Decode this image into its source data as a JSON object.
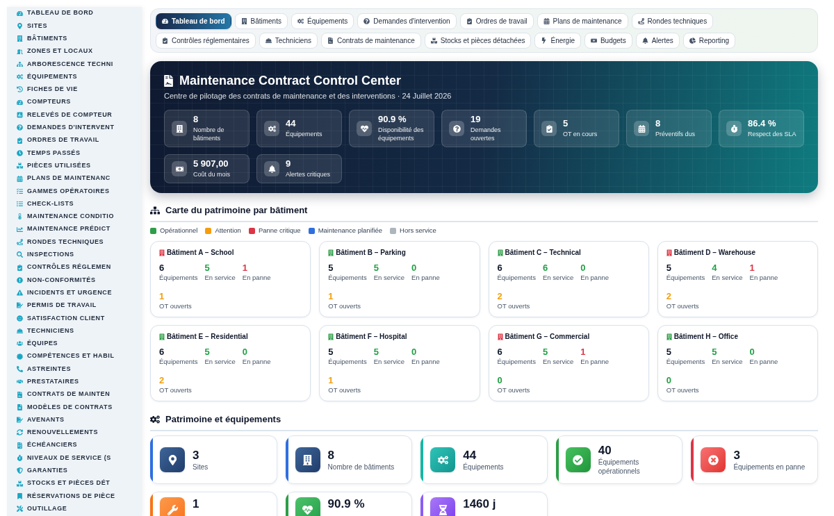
{
  "sidebar": {
    "items": [
      "TABLEAU DE BORD",
      "SITES",
      "BÂTIMENTS",
      "ZONES ET LOCAUX",
      "ARBORESCENCE TECHNI",
      "ÉQUIPEMENTS",
      "FICHES DE VIE",
      "COMPTEURS",
      "RELEVÉS DE COMPTEUR",
      "DEMANDES D'INTERVENT",
      "ORDRES DE TRAVAIL",
      "TEMPS PASSÉS",
      "PIÈCES UTILISÉES",
      "PLANS DE MAINTENANC",
      "GAMMES OPÉRATOIRES",
      "CHECK-LISTS",
      "MAINTENANCE CONDITIO",
      "MAINTENANCE PRÉDICT",
      "RONDES TECHNIQUES",
      "INSPECTIONS",
      "CONTRÔLES RÉGLEMEN",
      "NON-CONFORMITÉS",
      "INCIDENTS ET URGENCE",
      "PERMIS DE TRAVAIL",
      "SATISFACTION CLIENT",
      "TECHNICIENS",
      "ÉQUIPES",
      "COMPÉTENCES ET HABIL",
      "ASTREINTES",
      "PRESTATAIRES",
      "CONTRATS DE MAINTEN",
      "MODÈLES DE CONTRATS",
      "AVENANTS",
      "RENOUVELLEMENTS",
      "ÉCHÉANCIERS",
      "NIVEAUX DE SERVICE (S",
      "GARANTIES",
      "STOCKS ET PIÈCES DÉT",
      "RÉSERVATIONS DE PIÈCE",
      "OUTILLAGE"
    ]
  },
  "tab_rows": [
    [
      {
        "label": "Tableau de bord",
        "selected": true
      },
      {
        "label": "Bâtiments",
        "selected": false
      },
      {
        "label": "Équipements",
        "selected": false
      },
      {
        "label": "Demandes d'intervention",
        "selected": false
      },
      {
        "label": "Ordres de travail",
        "selected": false
      },
      {
        "label": "Plans de maintenance",
        "selected": false
      },
      {
        "label": "Rondes techniques",
        "selected": false
      }
    ],
    [
      {
        "label": "Contrôles réglementaires",
        "selected": false
      },
      {
        "label": "Techniciens",
        "selected": false
      },
      {
        "label": "Contrats de maintenance",
        "selected": false
      },
      {
        "label": "Stocks et pièces détachées",
        "selected": false
      },
      {
        "label": "Énergie",
        "selected": false
      },
      {
        "label": "Budgets",
        "selected": false
      },
      {
        "label": "Alertes",
        "selected": false
      },
      {
        "label": "Reporting",
        "selected": false
      }
    ]
  ],
  "hero": {
    "title": "Maintenance Contract Control Center",
    "subtitle": "Centre de pilotage des contrats de maintenance et des interventions · 24 Juillet 2026",
    "stats": [
      {
        "value": "8",
        "label": "Nombre de bâtiments"
      },
      {
        "value": "44",
        "label": "Équipements"
      },
      {
        "value": "90.9 %",
        "label": "Disponibilité des équipements"
      },
      {
        "value": "19",
        "label": "Demandes ouvertes"
      },
      {
        "value": "5",
        "label": "OT en cours"
      },
      {
        "value": "8",
        "label": "Préventifs dus"
      },
      {
        "value": "86.4 %",
        "label": "Respect des SLA"
      },
      {
        "value": "5 907,00",
        "label": "Coût du mois"
      },
      {
        "value": "9",
        "label": "Alertes critiques"
      }
    ]
  },
  "asset_map": {
    "title": "Carte du patrimoine par bâtiment",
    "legend": [
      {
        "label": "Opérationnel",
        "color": "#2e9e48"
      },
      {
        "label": "Attention",
        "color": "#f59e0b"
      },
      {
        "label": "Panne critique",
        "color": "#dc3545"
      },
      {
        "label": "Maintenance planifiée",
        "color": "#2f6fe0"
      },
      {
        "label": "Hors service",
        "color": "#adb5bd"
      }
    ],
    "buildings": [
      {
        "name": "Bâtiment A – School",
        "color": "#dc3545",
        "stats": [
          {
            "value": "6",
            "label": "Équipements",
            "color": "#0f172a"
          },
          {
            "value": "5",
            "label": "En service",
            "color": "#22a046"
          },
          {
            "value": "1",
            "label": "En panne",
            "color": "#dc3545"
          }
        ],
        "work_orders": {
          "value": "1",
          "label": "OT ouverts",
          "color": "#f59e0b"
        }
      },
      {
        "name": "Bâtiment B – Parking",
        "color": "#2e9e48",
        "stats": [
          {
            "value": "5",
            "label": "Équipements",
            "color": "#0f172a"
          },
          {
            "value": "5",
            "label": "En service",
            "color": "#22a046"
          },
          {
            "value": "0",
            "label": "En panne",
            "color": "#22a046"
          }
        ],
        "work_orders": {
          "value": "1",
          "label": "OT ouverts",
          "color": "#f59e0b"
        }
      },
      {
        "name": "Bâtiment C – Technical",
        "color": "#2e9e48",
        "stats": [
          {
            "value": "6",
            "label": "Équipements",
            "color": "#0f172a"
          },
          {
            "value": "6",
            "label": "En service",
            "color": "#22a046"
          },
          {
            "value": "0",
            "label": "En panne",
            "color": "#22a046"
          }
        ],
        "work_orders": {
          "value": "2",
          "label": "OT ouverts",
          "color": "#f59e0b"
        }
      },
      {
        "name": "Bâtiment D – Warehouse",
        "color": "#dc3545",
        "stats": [
          {
            "value": "5",
            "label": "Équipements",
            "color": "#0f172a"
          },
          {
            "value": "4",
            "label": "En service",
            "color": "#22a046"
          },
          {
            "value": "1",
            "label": "En panne",
            "color": "#dc3545"
          }
        ],
        "work_orders": {
          "value": "2",
          "label": "OT ouverts",
          "color": "#f59e0b"
        }
      },
      {
        "name": "Bâtiment E – Residential",
        "color": "#2e9e48",
        "stats": [
          {
            "value": "6",
            "label": "Équipements",
            "color": "#0f172a"
          },
          {
            "value": "5",
            "label": "En service",
            "color": "#22a046"
          },
          {
            "value": "0",
            "label": "En panne",
            "color": "#22a046"
          }
        ],
        "work_orders": {
          "value": "2",
          "label": "OT ouverts",
          "color": "#f59e0b"
        }
      },
      {
        "name": "Bâtiment F – Hospital",
        "color": "#2e9e48",
        "stats": [
          {
            "value": "5",
            "label": "Équipements",
            "color": "#0f172a"
          },
          {
            "value": "5",
            "label": "En service",
            "color": "#22a046"
          },
          {
            "value": "0",
            "label": "En panne",
            "color": "#22a046"
          }
        ],
        "work_orders": {
          "value": "1",
          "label": "OT ouverts",
          "color": "#f59e0b"
        }
      },
      {
        "name": "Bâtiment G – Commercial",
        "color": "#dc3545",
        "stats": [
          {
            "value": "6",
            "label": "Équipements",
            "color": "#0f172a"
          },
          {
            "value": "5",
            "label": "En service",
            "color": "#22a046"
          },
          {
            "value": "1",
            "label": "En panne",
            "color": "#dc3545"
          }
        ],
        "work_orders": {
          "value": "0",
          "label": "OT ouverts",
          "color": "#22a046"
        }
      },
      {
        "name": "Bâtiment H – Office",
        "color": "#2e9e48",
        "stats": [
          {
            "value": "5",
            "label": "Équipements",
            "color": "#0f172a"
          },
          {
            "value": "5",
            "label": "En service",
            "color": "#22a046"
          },
          {
            "value": "0",
            "label": "En panne",
            "color": "#22a046"
          }
        ],
        "work_orders": {
          "value": "0",
          "label": "OT ouverts",
          "color": "#22a046"
        }
      }
    ]
  },
  "assets": {
    "title": "Patrimoine et équipements",
    "cards": [
      {
        "value": "3",
        "label": "Sites",
        "color": "#2f6fe0"
      },
      {
        "value": "8",
        "label": "Nombre de bâtiments",
        "color": "#2f6fe0"
      },
      {
        "value": "44",
        "label": "Équipements",
        "color": "#14b8a6"
      },
      {
        "value": "40",
        "label": "Équipements opérationnels",
        "color": "#2e9e48"
      },
      {
        "value": "3",
        "label": "Équipements en panne",
        "color": "#dc3545"
      },
      {
        "value": "1",
        "color": "#f97316"
      },
      {
        "value": "90.9 %",
        "color": "#2e9e48"
      },
      {
        "value": "1460 j",
        "color": "#8b5cf6"
      }
    ]
  }
}
